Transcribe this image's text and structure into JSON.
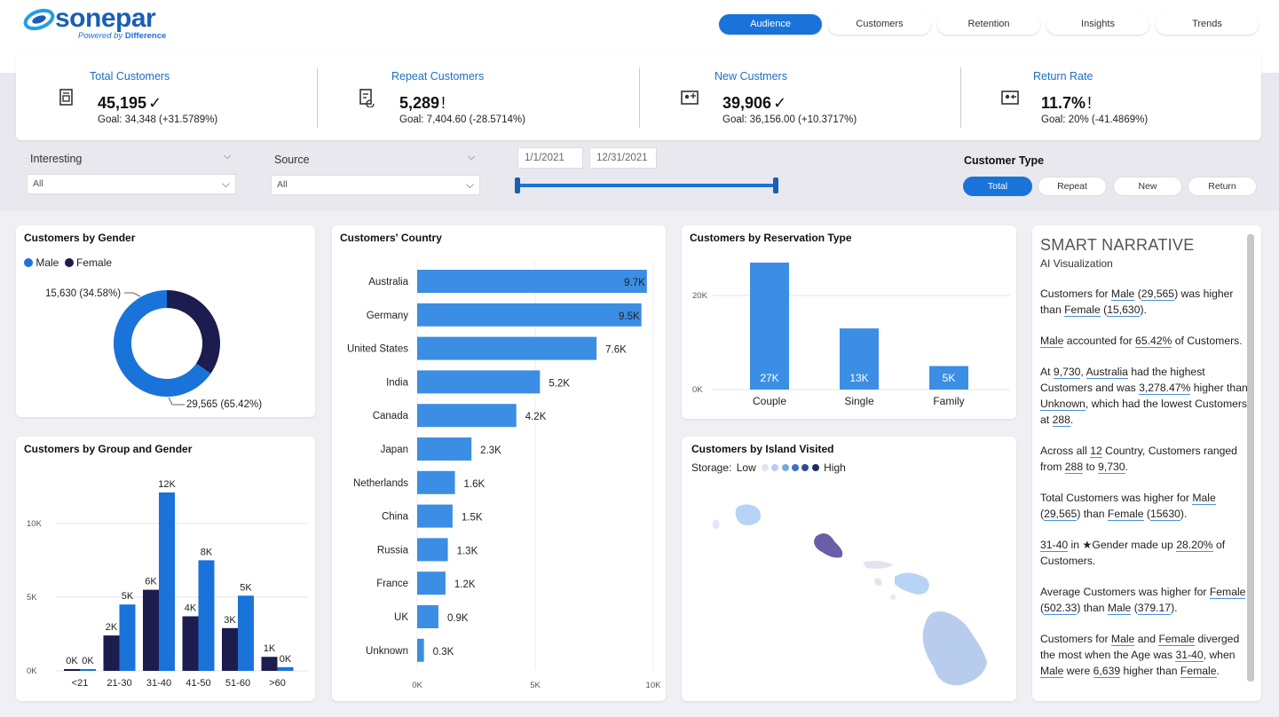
{
  "brand": {
    "name": "sonepar",
    "tagline_prefix": "Powered",
    "tagline_by": "by",
    "tagline_word": "Difference"
  },
  "nav": [
    {
      "label": "Audience",
      "active": true
    },
    {
      "label": "Customers",
      "active": false
    },
    {
      "label": "Retention",
      "active": false
    },
    {
      "label": "Insights",
      "active": false
    },
    {
      "label": "Trends",
      "active": false
    }
  ],
  "kpis": [
    {
      "title": "Total Customers",
      "value": "45,195",
      "status": "✓",
      "goal": "Goal: 34,348 (+31.5789%)",
      "icon": "document-icon"
    },
    {
      "title": "Repeat Customers",
      "value": "5,289",
      "status": "!",
      "goal": "Goal: 7,404.60 (-28.5714%)",
      "icon": "document-repeat-icon"
    },
    {
      "title": "New Custmers",
      "value": "39,906",
      "status": "✓",
      "goal": "Goal: 36,156.00 (+10.3717%)",
      "icon": "id-card-add-icon"
    },
    {
      "title": "Return Rate",
      "value": "11.7%",
      "status": "!",
      "goal": "Goal: 20% (-41.4869%)",
      "icon": "id-card-return-icon"
    }
  ],
  "filters": {
    "interesting": {
      "label": "Interesting",
      "value": "All"
    },
    "source": {
      "label": "Source",
      "value": "All"
    },
    "date_start": "1/1/2021",
    "date_end": "12/31/2021",
    "customer_type": {
      "label": "Customer Type",
      "options": [
        "Total",
        "Repeat",
        "New",
        "Return"
      ],
      "selected": "Total"
    }
  },
  "colors": {
    "accent": "#1a73d9",
    "male": "#1a73d9",
    "female": "#1c1c4e",
    "bar": "#3b8ee3"
  },
  "gender_chart": {
    "title": "Customers by Gender",
    "legend": [
      "Male",
      "Female"
    ],
    "female_label": "15,630 (34.58%)",
    "male_label": "29,565 (65.42%)"
  },
  "group_chart": {
    "title": "Customers by Group and Gender",
    "ticks": [
      "10K",
      "5K",
      "0K"
    ]
  },
  "country_chart": {
    "title": "Customers' Country",
    "ticks": [
      "0K",
      "5K",
      "10K"
    ]
  },
  "reservation_chart": {
    "title": "Customers by Reservation Type",
    "ticks": [
      "20K",
      "0K"
    ]
  },
  "island_chart": {
    "title": "Customers by Island Visited",
    "legend_prefix": "Storage:",
    "legend_low": "Low",
    "legend_high": "High"
  },
  "narrative": {
    "title": "SMART NARRATIVE",
    "subtitle": "AI Visualization"
  },
  "chart_data": [
    {
      "type": "pie",
      "title": "Customers by Gender",
      "categories": [
        "Male",
        "Female"
      ],
      "values": [
        29565,
        15630
      ],
      "labels": [
        "29,565 (65.42%)",
        "15,630 (34.58%)"
      ]
    },
    {
      "type": "bar",
      "title": "Customers by Group and Gender",
      "categories": [
        "<21",
        "21-30",
        "31-40",
        "41-50",
        "51-60",
        ">60"
      ],
      "series": [
        {
          "name": "Female",
          "values": [
            0,
            2400,
            5500,
            3700,
            2900,
            950
          ],
          "labels": [
            "0K",
            "2K",
            "6K",
            "4K",
            "3K",
            "1K"
          ]
        },
        {
          "name": "Male",
          "values": [
            0,
            4500,
            12100,
            7500,
            5100,
            250
          ],
          "labels": [
            "0K",
            "5K",
            "12K",
            "8K",
            "5K",
            "0K"
          ]
        }
      ],
      "ylim": [
        0,
        13000
      ]
    },
    {
      "type": "bar",
      "orientation": "horizontal",
      "title": "Customers' Country",
      "categories": [
        "Australia",
        "Germany",
        "United States",
        "India",
        "Canada",
        "Japan",
        "Netherlands",
        "China",
        "Russia",
        "France",
        "UK",
        "Unknown"
      ],
      "values": [
        9730,
        9500,
        7600,
        5200,
        4200,
        2300,
        1600,
        1500,
        1300,
        1200,
        900,
        288
      ],
      "labels": [
        "9.7K",
        "9.5K",
        "7.6K",
        "5.2K",
        "4.2K",
        "2.3K",
        "1.6K",
        "1.5K",
        "1.3K",
        "1.2K",
        "0.9K",
        "0.3K"
      ],
      "xlim": [
        0,
        10000
      ]
    },
    {
      "type": "bar",
      "title": "Customers by Reservation Type",
      "categories": [
        "Couple",
        "Single",
        "Family"
      ],
      "values": [
        27000,
        13000,
        5000
      ],
      "labels": [
        "27K",
        "13K",
        "5K"
      ],
      "ylim": [
        0,
        30000
      ]
    }
  ]
}
